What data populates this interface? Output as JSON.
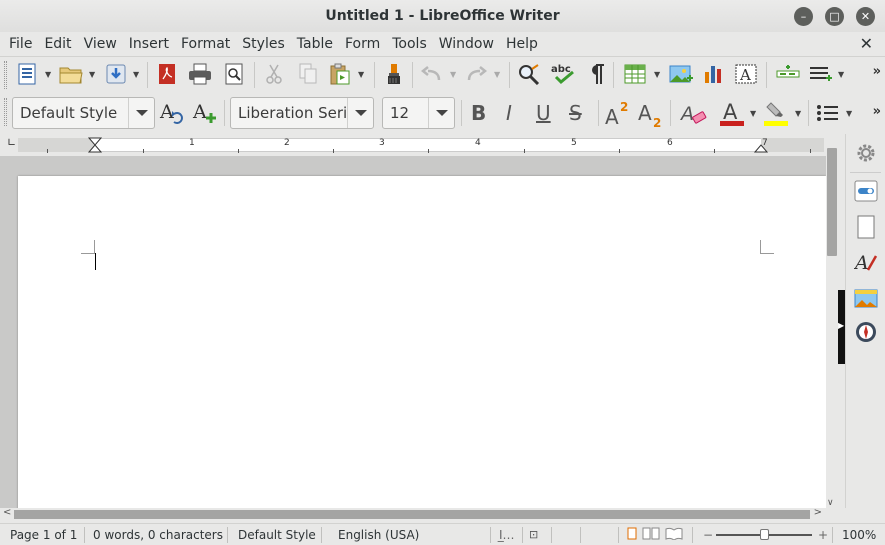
{
  "window": {
    "title": "Untitled 1 - LibreOffice Writer",
    "minimize_glyph": "–",
    "maximize_glyph": "□",
    "close_glyph": "✕"
  },
  "menubar": {
    "items": [
      "File",
      "Edit",
      "View",
      "Insert",
      "Format",
      "Styles",
      "Table",
      "Form",
      "Tools",
      "Window",
      "Help"
    ],
    "close_doc_glyph": "✕"
  },
  "standard_toolbar": {
    "icons": [
      "new-document-icon",
      "open-folder-icon",
      "save-icon",
      "export-pdf-icon",
      "print-icon",
      "print-preview-icon",
      "cut-icon",
      "copy-icon",
      "paste-icon",
      "clone-formatting-icon",
      "undo-icon",
      "redo-icon",
      "find-replace-icon",
      "spelling-icon",
      "formatting-marks-icon",
      "insert-table-icon",
      "insert-image-icon",
      "insert-chart-icon",
      "insert-textbox-icon",
      "insert-field-icon",
      "insert-special-icon"
    ],
    "more_glyph": "»"
  },
  "formatting_toolbar": {
    "paragraph_style": "Default Style",
    "font_name": "Liberation Serif",
    "font_size": "12",
    "bold_label": "B",
    "italic_label": "I",
    "underline_label": "U",
    "strike_label": "S",
    "more_glyph": "»",
    "font_color": "#c9211e",
    "highlight_color": "#ffff00"
  },
  "ruler": {
    "numbers": [
      "1",
      "2",
      "3",
      "4",
      "5",
      "6",
      "7"
    ]
  },
  "statusbar": {
    "page": "Page 1 of 1",
    "words": "0 words, 0 characters",
    "page_style": "Default Style",
    "language": "English (USA)",
    "zoom": "100%",
    "zoom_minus": "−",
    "zoom_plus": "+"
  },
  "colors": {
    "title_bg": "#e4e4e3",
    "doc_bg": "#c9c9c8",
    "accent_orange": "#e06c00"
  }
}
